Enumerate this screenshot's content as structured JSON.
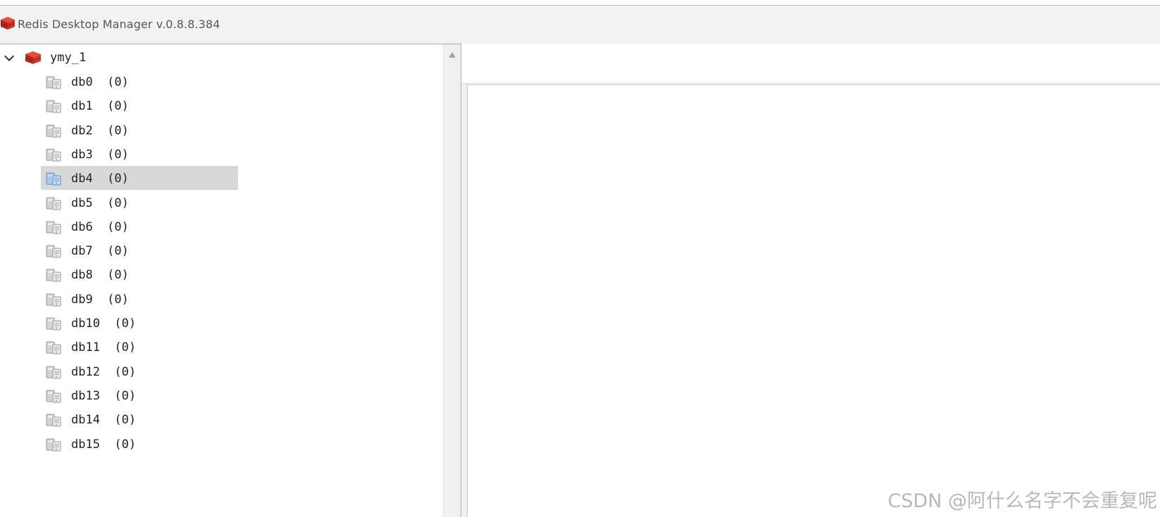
{
  "window": {
    "title": "Redis Desktop Manager v.0.8.8.384",
    "app_icon": "redis-cube-icon",
    "accent_red": "#d12c2c"
  },
  "tree": {
    "connection": {
      "label": "ymy_1",
      "expanded": true,
      "icon": "redis-server-icon"
    },
    "selected_index": 4,
    "databases": [
      {
        "label": "db0  (0)"
      },
      {
        "label": "db1  (0)"
      },
      {
        "label": "db2  (0)"
      },
      {
        "label": "db3  (0)"
      },
      {
        "label": "db4  (0)"
      },
      {
        "label": "db5  (0)"
      },
      {
        "label": "db6  (0)"
      },
      {
        "label": "db7  (0)"
      },
      {
        "label": "db8  (0)"
      },
      {
        "label": "db9  (0)"
      },
      {
        "label": "db10  (0)"
      },
      {
        "label": "db11  (0)"
      },
      {
        "label": "db12  (0)"
      },
      {
        "label": "db13  (0)"
      },
      {
        "label": "db14  (0)"
      },
      {
        "label": "db15  (0)"
      }
    ]
  },
  "watermark": "CSDN @阿什么名字不会重复呢"
}
